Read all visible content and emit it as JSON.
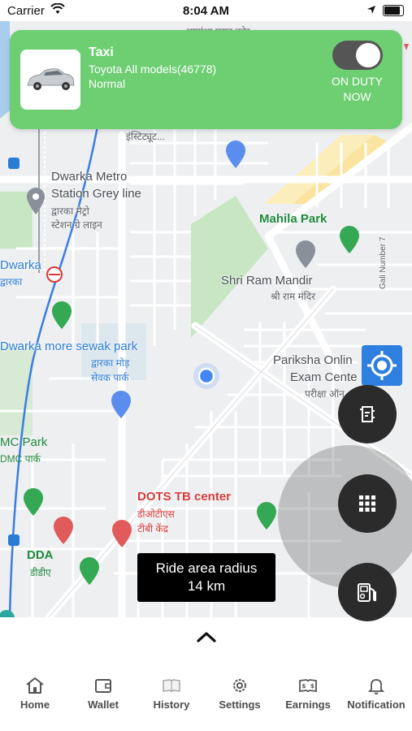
{
  "status_bar": {
    "carrier": "Carrier",
    "time": "8:04 AM"
  },
  "taxi_card": {
    "title": "Taxi",
    "model": "Toyota All models(46778)",
    "category": "Normal",
    "duty_line1": "ON DUTY",
    "duty_line2": "NOW",
    "on_duty": true
  },
  "map_labels": {
    "metro_en1": "Dwarka Metro",
    "metro_en2": "Station Grey line",
    "metro_hi1": "द्वारका मेट्रो",
    "metro_hi2": "स्टेशन ग्रे लाइन",
    "dwarka_en": "Dwarka",
    "dwarka_hi": "द्वारका",
    "sewak_en": "Dwarka more sewak park",
    "sewak_hi1": "द्वारका मोड़",
    "sewak_hi2": "सेवक पार्क",
    "institute_hi": "इंस्टिट्यूट...",
    "top_hi": "आपांशा पराड बड़ेर",
    "mahila_park": "Mahila Park",
    "temple_en": "Shri Ram Mandir",
    "temple_hi": "श्री राम मंदिर",
    "pariksha_en1": "Pariksha Onlin",
    "pariksha_en2": "Exam Cente",
    "pariksha_hi": "परीक्षा ऑन",
    "gali": "Gali Number 7",
    "dmc_en": "MC Park",
    "dmc_hi": "DMC पार्क",
    "dots_en": "DOTS TB center",
    "dots_hi1": "डीओटीएस",
    "dots_hi2": "टीबी केंद्र",
    "dda_en": "DDA",
    "dda_hi": "डीडीए"
  },
  "ride_radius": {
    "line1": "Ride area radius",
    "line2": "14 km"
  },
  "nav": [
    {
      "label": "Home",
      "icon": "home-icon"
    },
    {
      "label": "Wallet",
      "icon": "wallet-icon"
    },
    {
      "label": "History",
      "icon": "history-icon"
    },
    {
      "label": "Settings",
      "icon": "settings-icon"
    },
    {
      "label": "Earnings",
      "icon": "earnings-icon"
    },
    {
      "label": "Notification",
      "icon": "bell-icon"
    }
  ],
  "colors": {
    "card_green": "#6ece72",
    "accent_blue": "#2f7fe0",
    "fab_dark": "#2b2b2b",
    "park_green": "#c8e6c4"
  }
}
